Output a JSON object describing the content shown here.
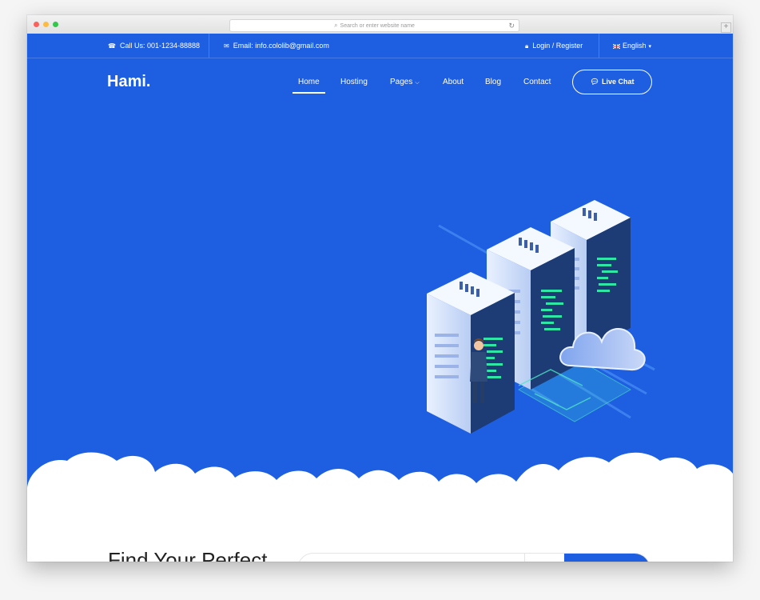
{
  "browser": {
    "url_placeholder": "Search or enter website name"
  },
  "topbar": {
    "phone": "Call Us: 001-1234-88888",
    "email": "Email: info.cololib@gmail.com",
    "login": "Login / Register",
    "language": "English"
  },
  "header": {
    "logo": "Hami.",
    "nav": [
      "Home",
      "Hosting",
      "Pages",
      "About",
      "Blog",
      "Contact"
    ],
    "active_nav": "Home",
    "cta": "Live Chat"
  },
  "hero": {
    "illustration": "server-racks-cloud-illustration"
  },
  "section": {
    "title": "Find Your Perfect"
  },
  "colors": {
    "brand_blue": "#1e5fe1",
    "white": "#ffffff"
  }
}
